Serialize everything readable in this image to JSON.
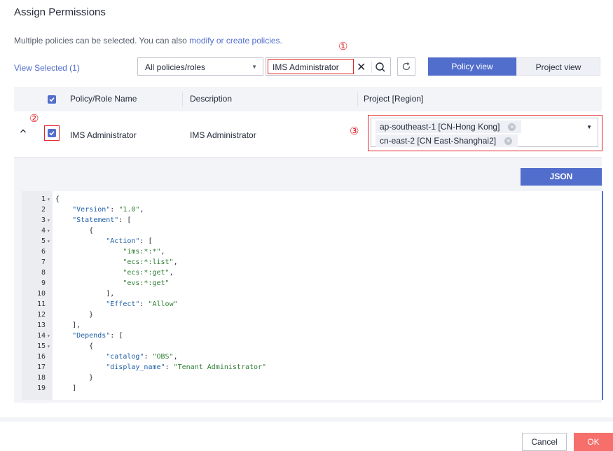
{
  "dialog": {
    "title": "Assign Permissions",
    "description_prefix": "Multiple policies can be selected. You can also ",
    "description_link": "modify or create policies.",
    "annotation_1": "①",
    "annotation_2": "②",
    "annotation_3": "③"
  },
  "toolbar": {
    "view_selected": "View Selected (1)",
    "filter_value": "All policies/roles",
    "search_value": "IMS Administrator",
    "policy_view_label": "Policy view",
    "project_view_label": "Project view"
  },
  "table": {
    "headers": [
      "Policy/Role Name",
      "Description",
      "Project [Region]"
    ],
    "row": {
      "name": "IMS Administrator",
      "description": "IMS Administrator",
      "regions": [
        "ap-southeast-1 [CN-Hong Kong]",
        "cn-east-2 [CN East-Shanghai2]"
      ]
    }
  },
  "detail": {
    "json_button": "JSON",
    "code_lines": [
      {
        "n": "1",
        "fold": true,
        "text": "{"
      },
      {
        "n": "2",
        "fold": false,
        "text": "    \"Version\": \"1.0\","
      },
      {
        "n": "3",
        "fold": true,
        "text": "    \"Statement\": ["
      },
      {
        "n": "4",
        "fold": true,
        "text": "        {"
      },
      {
        "n": "5",
        "fold": true,
        "text": "            \"Action\": ["
      },
      {
        "n": "6",
        "fold": false,
        "text": "                \"ims:*:*\","
      },
      {
        "n": "7",
        "fold": false,
        "text": "                \"ecs:*:list\","
      },
      {
        "n": "8",
        "fold": false,
        "text": "                \"ecs:*:get\","
      },
      {
        "n": "9",
        "fold": false,
        "text": "                \"evs:*:get\""
      },
      {
        "n": "10",
        "fold": false,
        "text": "            ],"
      },
      {
        "n": "11",
        "fold": false,
        "text": "            \"Effect\": \"Allow\""
      },
      {
        "n": "12",
        "fold": false,
        "text": "        }"
      },
      {
        "n": "13",
        "fold": false,
        "text": "    ],"
      },
      {
        "n": "14",
        "fold": true,
        "text": "    \"Depends\": ["
      },
      {
        "n": "15",
        "fold": true,
        "text": "        {"
      },
      {
        "n": "16",
        "fold": false,
        "text": "            \"catalog\": \"OBS\","
      },
      {
        "n": "17",
        "fold": false,
        "text": "            \"display_name\": \"Tenant Administrator\""
      },
      {
        "n": "18",
        "fold": false,
        "text": "        }"
      },
      {
        "n": "19",
        "fold": false,
        "text": "    ]"
      }
    ]
  },
  "footer": {
    "cancel_label": "Cancel",
    "ok_label": "OK"
  },
  "colors": {
    "accent": "#526ecc",
    "highlight": "#e0262b",
    "ok_button": "#f66f6a"
  }
}
